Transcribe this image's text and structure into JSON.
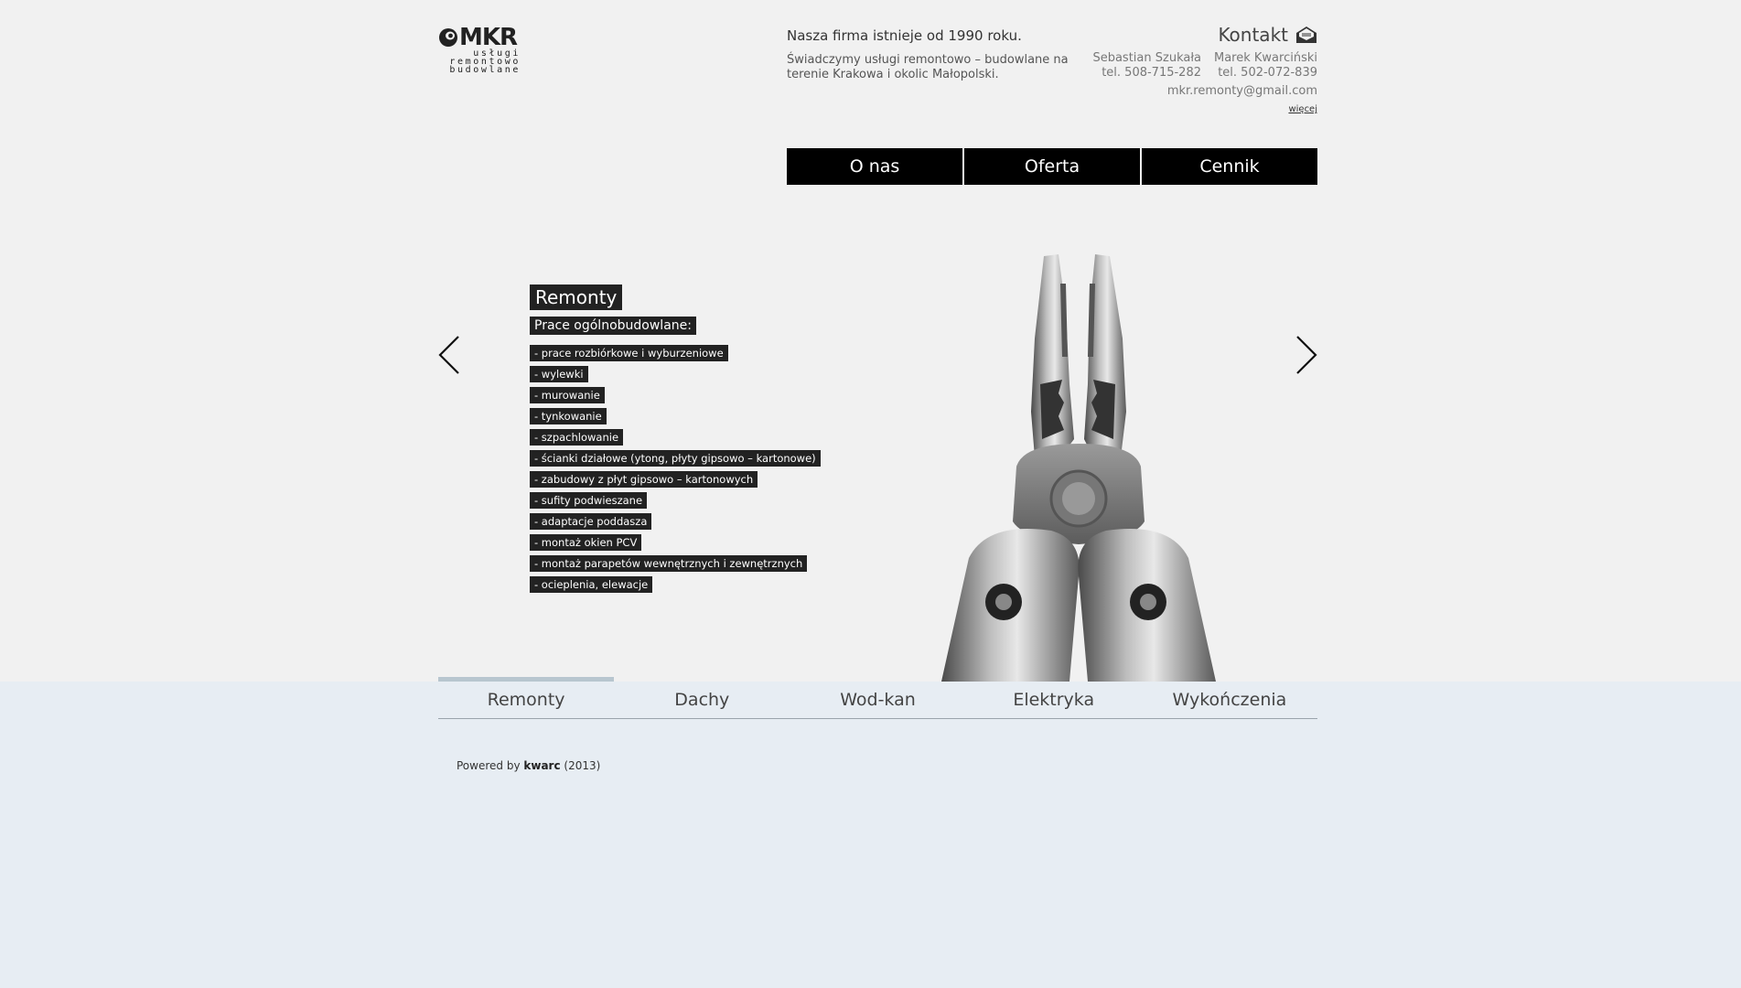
{
  "logo": {
    "text": "MKR",
    "sub_lines": [
      "usługi",
      "remontowo",
      "budowlane"
    ]
  },
  "about": {
    "line1": "Nasza firma istnieje od 1990 roku.",
    "line2": "Świadczymy usługi remontowo – budowlane na terenie Krakowa i okolic Małopolski."
  },
  "contact": {
    "title": "Kontakt",
    "persons": [
      {
        "name": "Sebastian Szukała",
        "phone": "tel. 508-715-282"
      },
      {
        "name": "Marek Kwarciński",
        "phone": "tel. 502-072-839"
      }
    ],
    "email": "mkr.remonty@gmail.com",
    "more": "więcej"
  },
  "menu": {
    "items": [
      "O nas",
      "Oferta",
      "Cennik"
    ]
  },
  "slide": {
    "title": "Remonty",
    "subtitle": "Prace ogólnobudowlane:",
    "items": [
      "- prace rozbiórkowe i wyburzeniowe",
      "- wylewki",
      "- murowanie",
      "- tynkowanie",
      "- szpachlowanie",
      "- ścianki działowe (ytong, płyty gipsowo – kartonowe)",
      "- zabudowy z płyt gipsowo – kartonowych",
      "- sufity podwieszane",
      "- adaptacje poddasza",
      "- montaż okien PCV",
      "- montaż parapetów wewnętrznych i zewnętrznych",
      "- ocieplenia, elewacje"
    ]
  },
  "tabs": {
    "items": [
      "Remonty",
      "Dachy",
      "Wod-kan",
      "Elektryka",
      "Wykończenia"
    ],
    "active_index": 0
  },
  "footer": {
    "prefix": "Powered by",
    "author": "kwarc",
    "year": "(2013)"
  },
  "colors": {
    "top_bg": "#f1f1f1",
    "bottom_bg": "#e7edf3",
    "menu_bg": "#000000",
    "label_bg": "#222222",
    "tab_active": "#b8c6cf"
  }
}
